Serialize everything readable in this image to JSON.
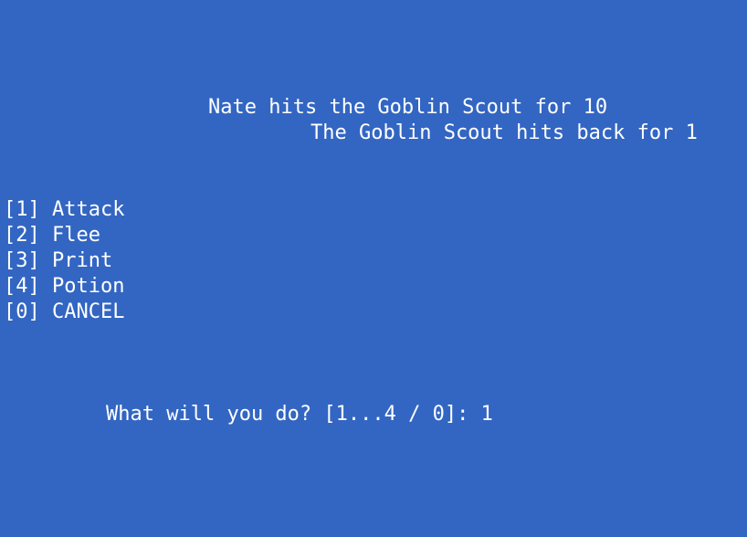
{
  "combat_log": [
    "Nate hits the Goblin Scout for 10",
    "The Goblin Scout hits back for 1"
  ],
  "menu": {
    "items": [
      {
        "key": "[1]",
        "label": "Attack"
      },
      {
        "key": "[2]",
        "label": "Flee"
      },
      {
        "key": "[3]",
        "label": "Print"
      },
      {
        "key": "[4]",
        "label": "Potion"
      },
      {
        "key": "[0]",
        "label": "CANCEL"
      }
    ]
  },
  "prompt": {
    "text": "What will you do? [1...4 / 0]:",
    "input": "1"
  },
  "colors": {
    "background": "#3366c2",
    "text": "#ffffff"
  }
}
